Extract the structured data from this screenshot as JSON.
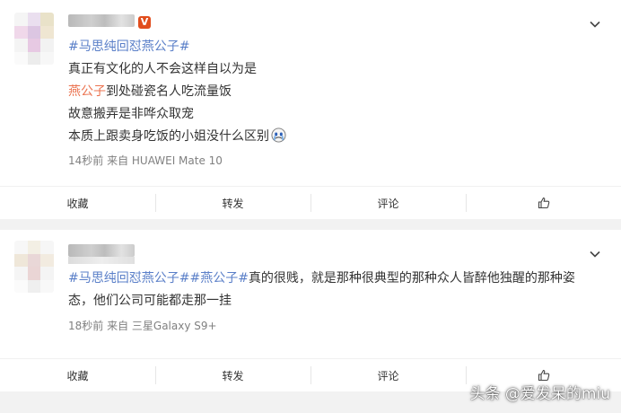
{
  "posts": [
    {
      "hashtag": "#马思纯回怼燕公子#",
      "lines": [
        "真正有文化的人不会这样自以为是",
        "到处碰瓷名人吃流量饭",
        "故意搬弄是非哗众取宠",
        "本质上跟卖身吃饭的小姐没什么区别"
      ],
      "mention": "燕公子",
      "meta": "14秒前 来自 HUAWEI Mate 10",
      "actions": {
        "collect": "收藏",
        "repost": "转发",
        "comment": "评论"
      },
      "emoji_icon": "crying-face-icon"
    },
    {
      "hashtag1": "#马思纯回怼燕公子#",
      "hashtag2": "#燕公子#",
      "text": "真的很贱，就是那种很典型的那种众人皆醉他独醒的那种姿态，他们公司可能都走那一挂",
      "meta": "18秒前 来自 三星Galaxy S9+",
      "actions": {
        "collect": "收藏",
        "repost": "转发",
        "comment": "评论"
      }
    }
  ],
  "watermark": "头条 @爱发呆的miu",
  "colors": {
    "hashtag": "#eb7350",
    "hashtag_blue": "#5a7fc8",
    "vip_badge": "#e14d1d"
  },
  "icons": [
    "chevron-down-icon",
    "like-icon",
    "vip-badge-icon"
  ]
}
